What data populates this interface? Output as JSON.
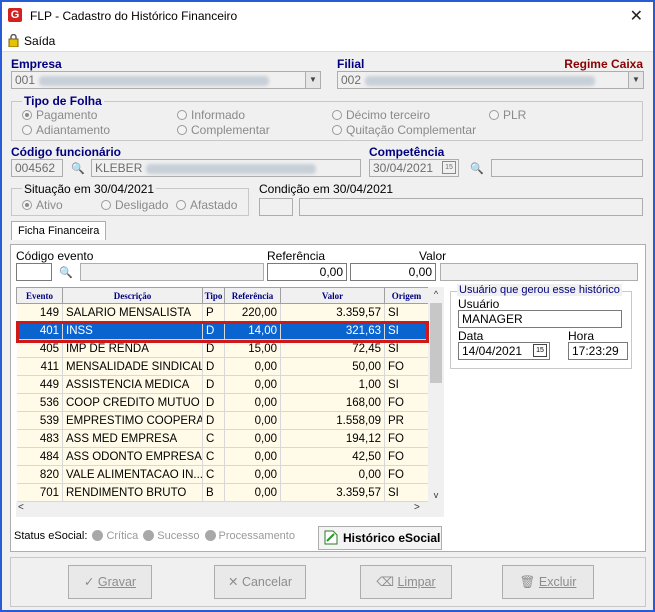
{
  "window": {
    "title": "FLP - Cadastro do Histórico Financeiro",
    "close_glyph": "✕",
    "app_icon": "G"
  },
  "menu": {
    "saida": "Saída"
  },
  "empresa": {
    "label": "Empresa",
    "code": "001"
  },
  "filial": {
    "label": "Filial",
    "code": "002"
  },
  "regime": {
    "label": "Regime Caixa"
  },
  "tipo_folha": {
    "title": "Tipo de Folha",
    "options": [
      "Pagamento",
      "Informado",
      "Décimo terceiro",
      "PLR",
      "Adiantamento",
      "Complementar",
      "Quitação Complementar"
    ],
    "selected": "Pagamento"
  },
  "funcionario": {
    "label": "Código funcionário",
    "code": "004562",
    "name": "KLEBER"
  },
  "competencia": {
    "label": "Competência",
    "value": "30/04/2021"
  },
  "situacao": {
    "title": "Situação em 30/04/2021",
    "options": [
      "Ativo",
      "Desligado",
      "Afastado"
    ],
    "selected": "Ativo"
  },
  "condicao": {
    "title": "Condição em 30/04/2021"
  },
  "tab": {
    "label": "Ficha Financeira"
  },
  "filters": {
    "codigo_label": "Código evento",
    "referencia_label": "Referência",
    "referencia_value": "0,00",
    "valor_label": "Valor",
    "valor_value": "0,00"
  },
  "table": {
    "headers": [
      "Evento",
      "Descrição",
      "Tipo",
      "Referência",
      "Valor",
      "Origem"
    ],
    "rows": [
      [
        "149",
        "SALARIO MENSALISTA",
        "P",
        "220,00",
        "3.359,57",
        "SI"
      ],
      [
        "401",
        "INSS",
        "D",
        "14,00",
        "321,63",
        "SI"
      ],
      [
        "405",
        "IMP DE RENDA",
        "D",
        "15,00",
        "72,45",
        "SI"
      ],
      [
        "411",
        "MENSALIDADE SINDICAL",
        "D",
        "0,00",
        "50,00",
        "FO"
      ],
      [
        "449",
        "ASSISTENCIA MEDICA",
        "D",
        "0,00",
        "1,00",
        "SI"
      ],
      [
        "536",
        "COOP CREDITO MUTUO",
        "D",
        "0,00",
        "168,00",
        "FO"
      ],
      [
        "539",
        "EMPRESTIMO COOPERAT",
        "D",
        "0,00",
        "1.558,09",
        "PR"
      ],
      [
        "483",
        "ASS MED EMPRESA",
        "C",
        "0,00",
        "194,12",
        "FO"
      ],
      [
        "484",
        "ASS ODONTO EMPRESA",
        "C",
        "0,00",
        "42,50",
        "FO"
      ],
      [
        "820",
        "VALE ALIMENTACAO IN...",
        "C",
        "0,00",
        "0,00",
        "FO"
      ],
      [
        "701",
        "RENDIMENTO BRUTO",
        "B",
        "0,00",
        "3.359,57",
        "SI"
      ]
    ],
    "selected_index": 1
  },
  "usuario_box": {
    "title": "Usuário que gerou esse histórico",
    "usuario_label": "Usuário",
    "usuario": "MANAGER",
    "data_label": "Data",
    "data": "14/04/2021",
    "hora_label": "Hora",
    "hora": "17:23:29"
  },
  "status": {
    "label": "Status eSocial:",
    "critica": "Crítica",
    "sucesso": "Sucesso",
    "processamento": "Processamento",
    "historico_button": "Histórico eSocial"
  },
  "buttons": {
    "gravar": "Gravar",
    "cancelar": "Cancelar",
    "limpar": "Limpar",
    "excluir": "Excluir"
  }
}
